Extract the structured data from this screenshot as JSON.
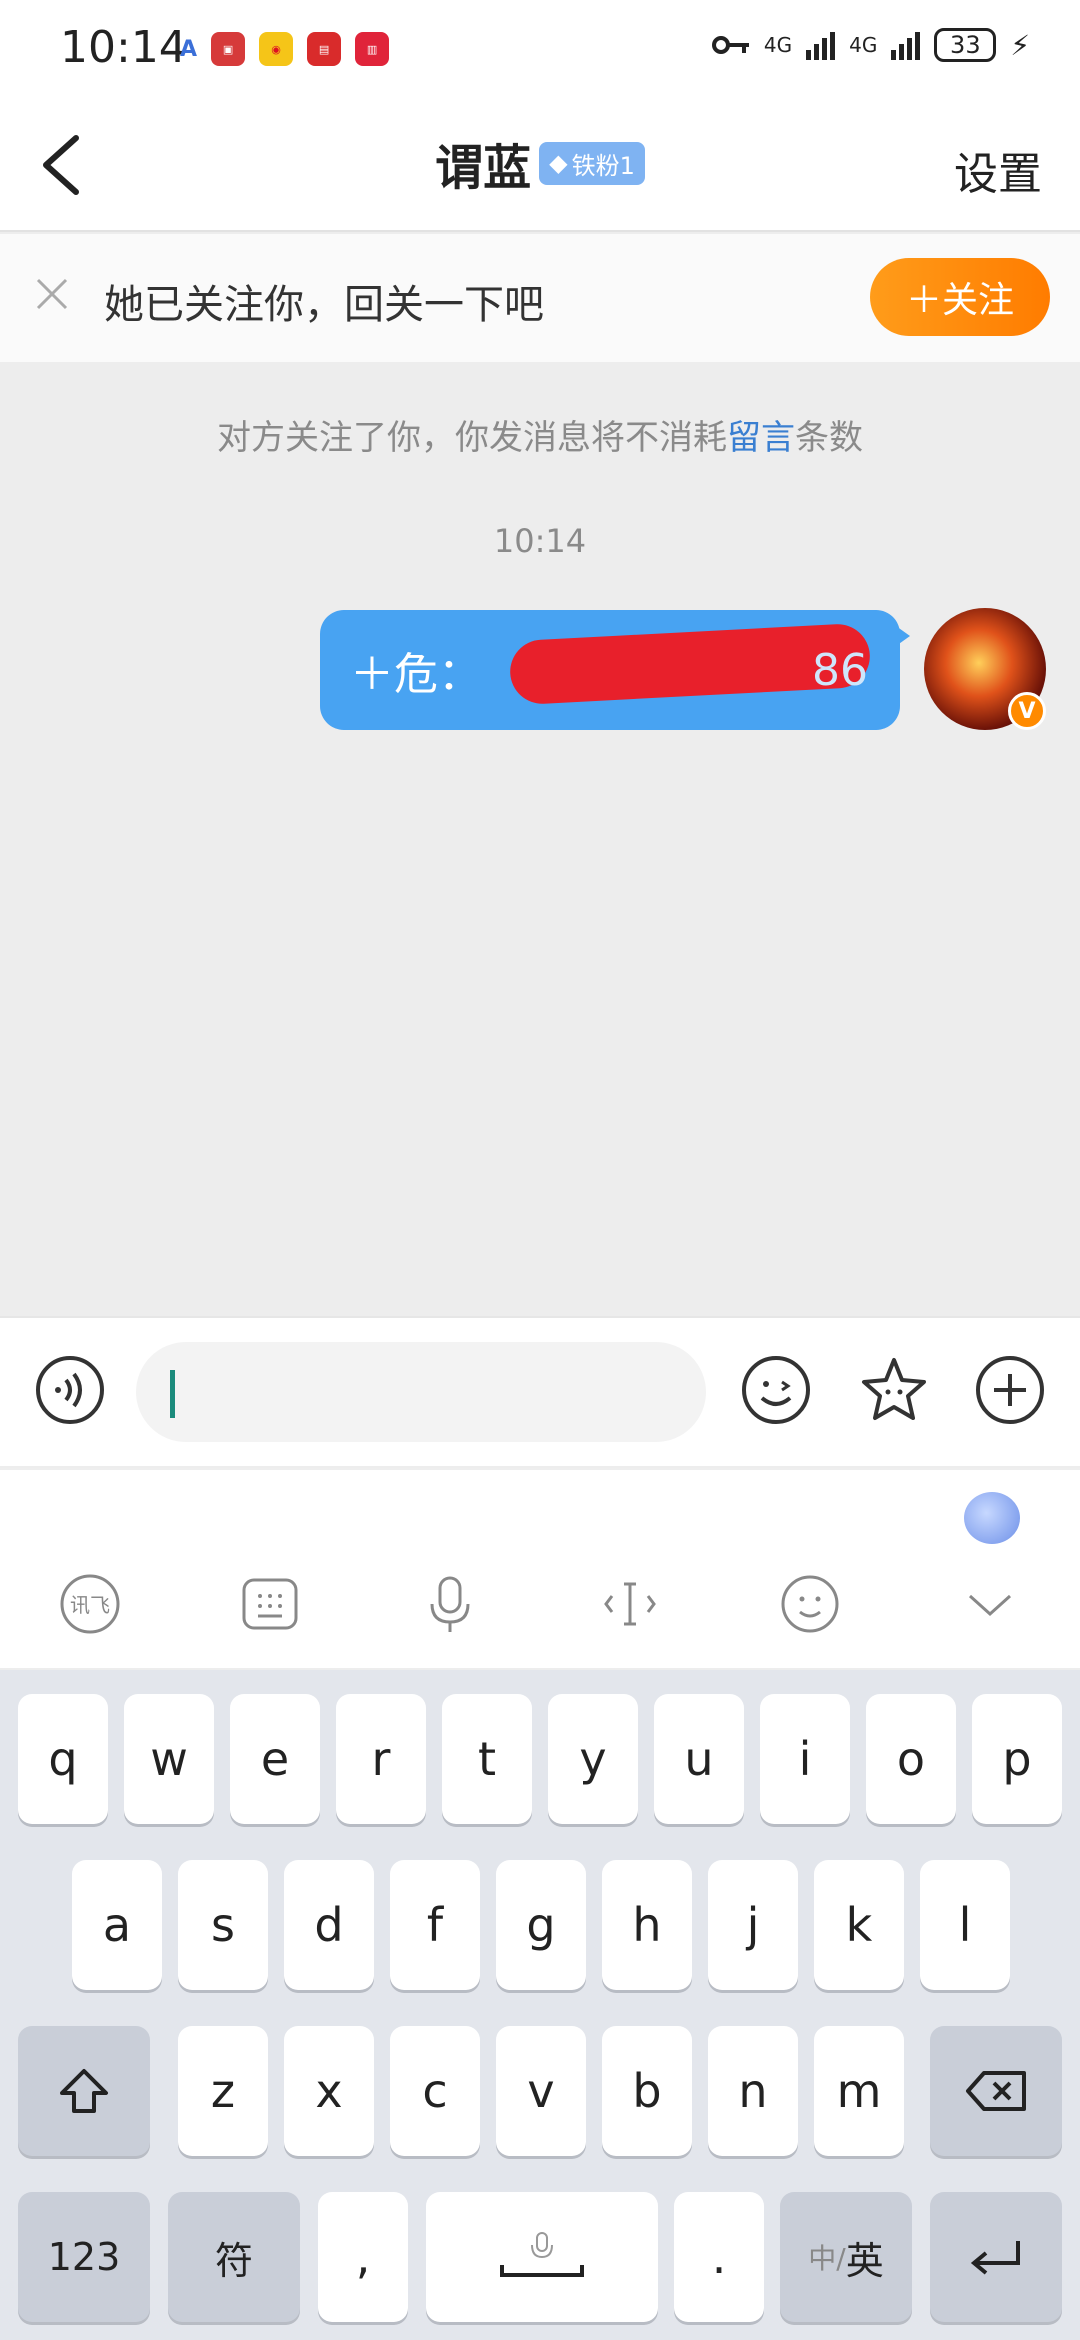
{
  "status_bar": {
    "time": "10:14",
    "battery": "33",
    "network_1": "4G",
    "network_2": "4G"
  },
  "header": {
    "title": "谓蓝",
    "fan_badge": "铁粉1",
    "settings_label": "设置"
  },
  "follow_banner": {
    "text": "她已关注你，回关一下吧",
    "follow_button": "＋关注"
  },
  "chat": {
    "notice_prefix": "对方关注了你，你发消息将不消耗",
    "notice_link": "留言",
    "notice_suffix": "条数",
    "timestamp": "10:14",
    "message_start": "＋危：",
    "message_end": "86"
  },
  "input": {
    "placeholder": ""
  },
  "keyboard": {
    "row1": [
      "q",
      "w",
      "e",
      "r",
      "t",
      "y",
      "u",
      "i",
      "o",
      "p"
    ],
    "row2": [
      "a",
      "s",
      "d",
      "f",
      "g",
      "h",
      "j",
      "k",
      "l"
    ],
    "row3": [
      "z",
      "x",
      "c",
      "v",
      "b",
      "n",
      "m"
    ],
    "num_key": "123",
    "symbol_key": "符",
    "comma_key": ",",
    "period_key": ".",
    "lang_key_zh": "中/",
    "lang_key_en": "英"
  },
  "colors": {
    "accent_orange": "#ff8a00",
    "bubble_blue": "#48a3f2",
    "link_blue": "#3a7fd1"
  }
}
